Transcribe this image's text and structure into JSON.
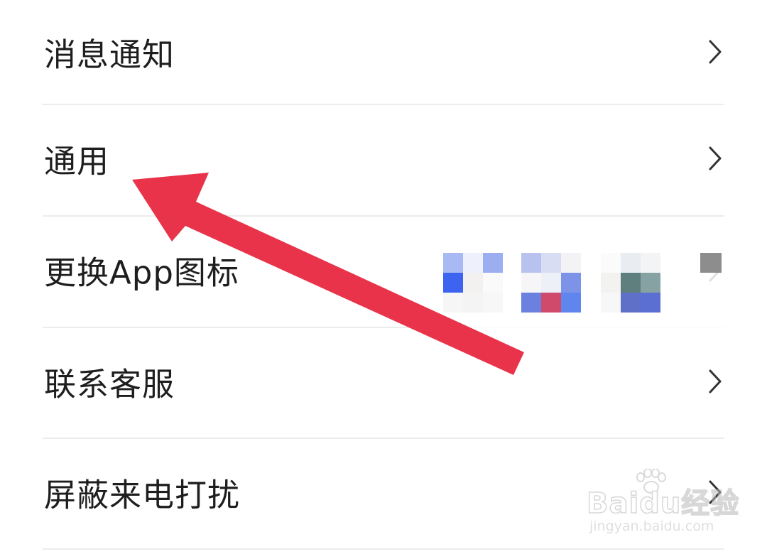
{
  "settings": {
    "items": [
      {
        "label": "消息通知",
        "chevron": "chevron-right-icon"
      },
      {
        "label": "通用",
        "chevron": "chevron-right-icon"
      },
      {
        "label": "更换App图标",
        "chevron": "chevron-right-icon"
      },
      {
        "label": "联系客服",
        "chevron": "chevron-right-icon"
      },
      {
        "label": "屏蔽来电打扰",
        "chevron": "chevron-right-icon"
      }
    ]
  },
  "annotation": {
    "type": "arrow",
    "color": "#e8334a",
    "points_to": "通用"
  },
  "watermark": {
    "brand": "Baidu经验",
    "url": "jingyan.baidu.com"
  },
  "colors": {
    "background": "#ffffff",
    "text": "#1e1e1e",
    "divider": "#ececec",
    "chevron": "#333333",
    "arrow": "#e8334a"
  }
}
